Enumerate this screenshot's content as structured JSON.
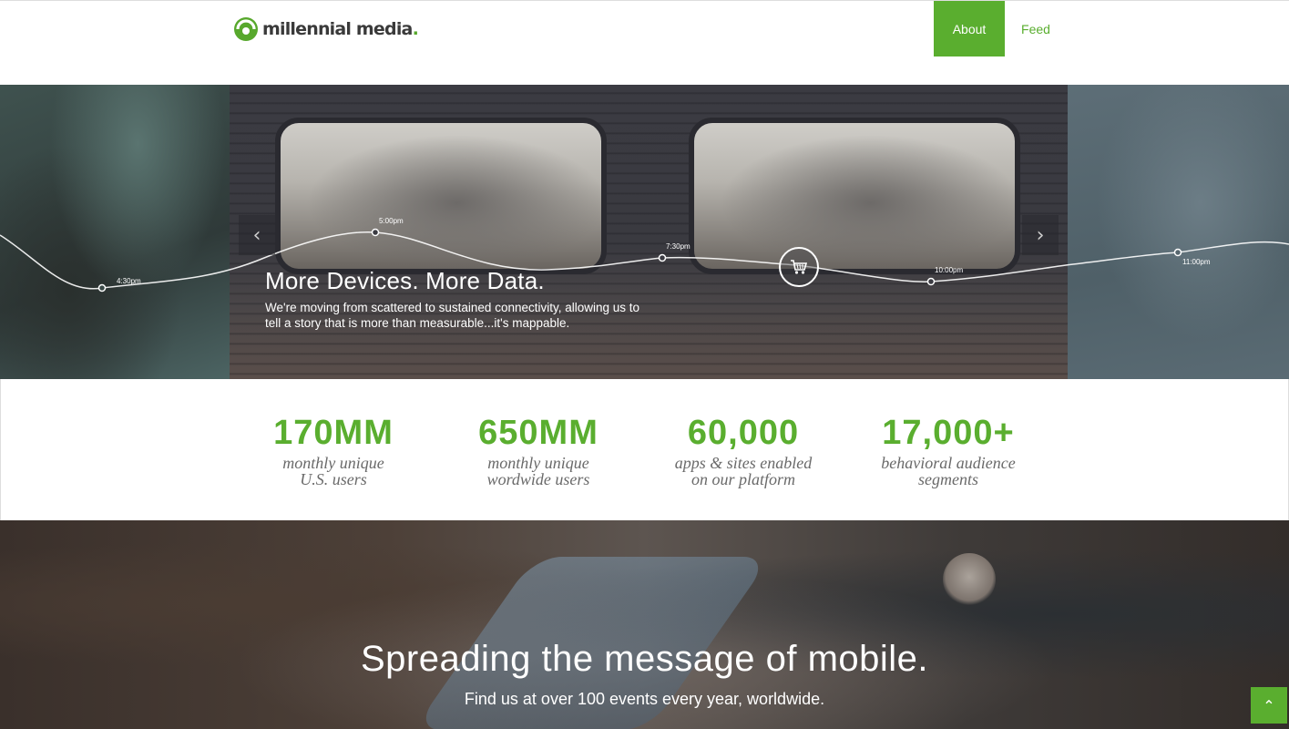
{
  "header": {
    "logo_text": "millennial media",
    "logo_dot": ".",
    "nav": [
      {
        "label": "About",
        "active": true
      },
      {
        "label": "Feed",
        "active": false
      }
    ],
    "accent_color": "#5aae2f"
  },
  "hero": {
    "title": "More Devices. More Data.",
    "subtitle": "We're moving from scattered to sustained connectivity, allowing us to tell a story that is more than measurable...it's mappable.",
    "times": [
      "4:30pm",
      "5:00pm",
      "7:30pm",
      "10:00pm",
      "11:00pm"
    ],
    "prev_icon": "chevron-left-icon",
    "next_icon": "chevron-right-icon",
    "cart_icon": "shopping-cart-icon"
  },
  "stats": [
    {
      "value": "170MM",
      "label_line1": "monthly unique",
      "label_line2": "U.S. users"
    },
    {
      "value": "650MM",
      "label_line1": "monthly unique",
      "label_line2": "wordwide users"
    },
    {
      "value": "60,000",
      "label_line1": "apps & sites enabled",
      "label_line2": "on our platform"
    },
    {
      "value": "17,000+",
      "label_line1": "behavioral audience",
      "label_line2": "segments"
    }
  ],
  "events": {
    "title": "Spreading the message of mobile.",
    "subtitle": "Find us at over 100 events every year, worldwide."
  },
  "scroll_top_icon": "chevron-up-icon"
}
